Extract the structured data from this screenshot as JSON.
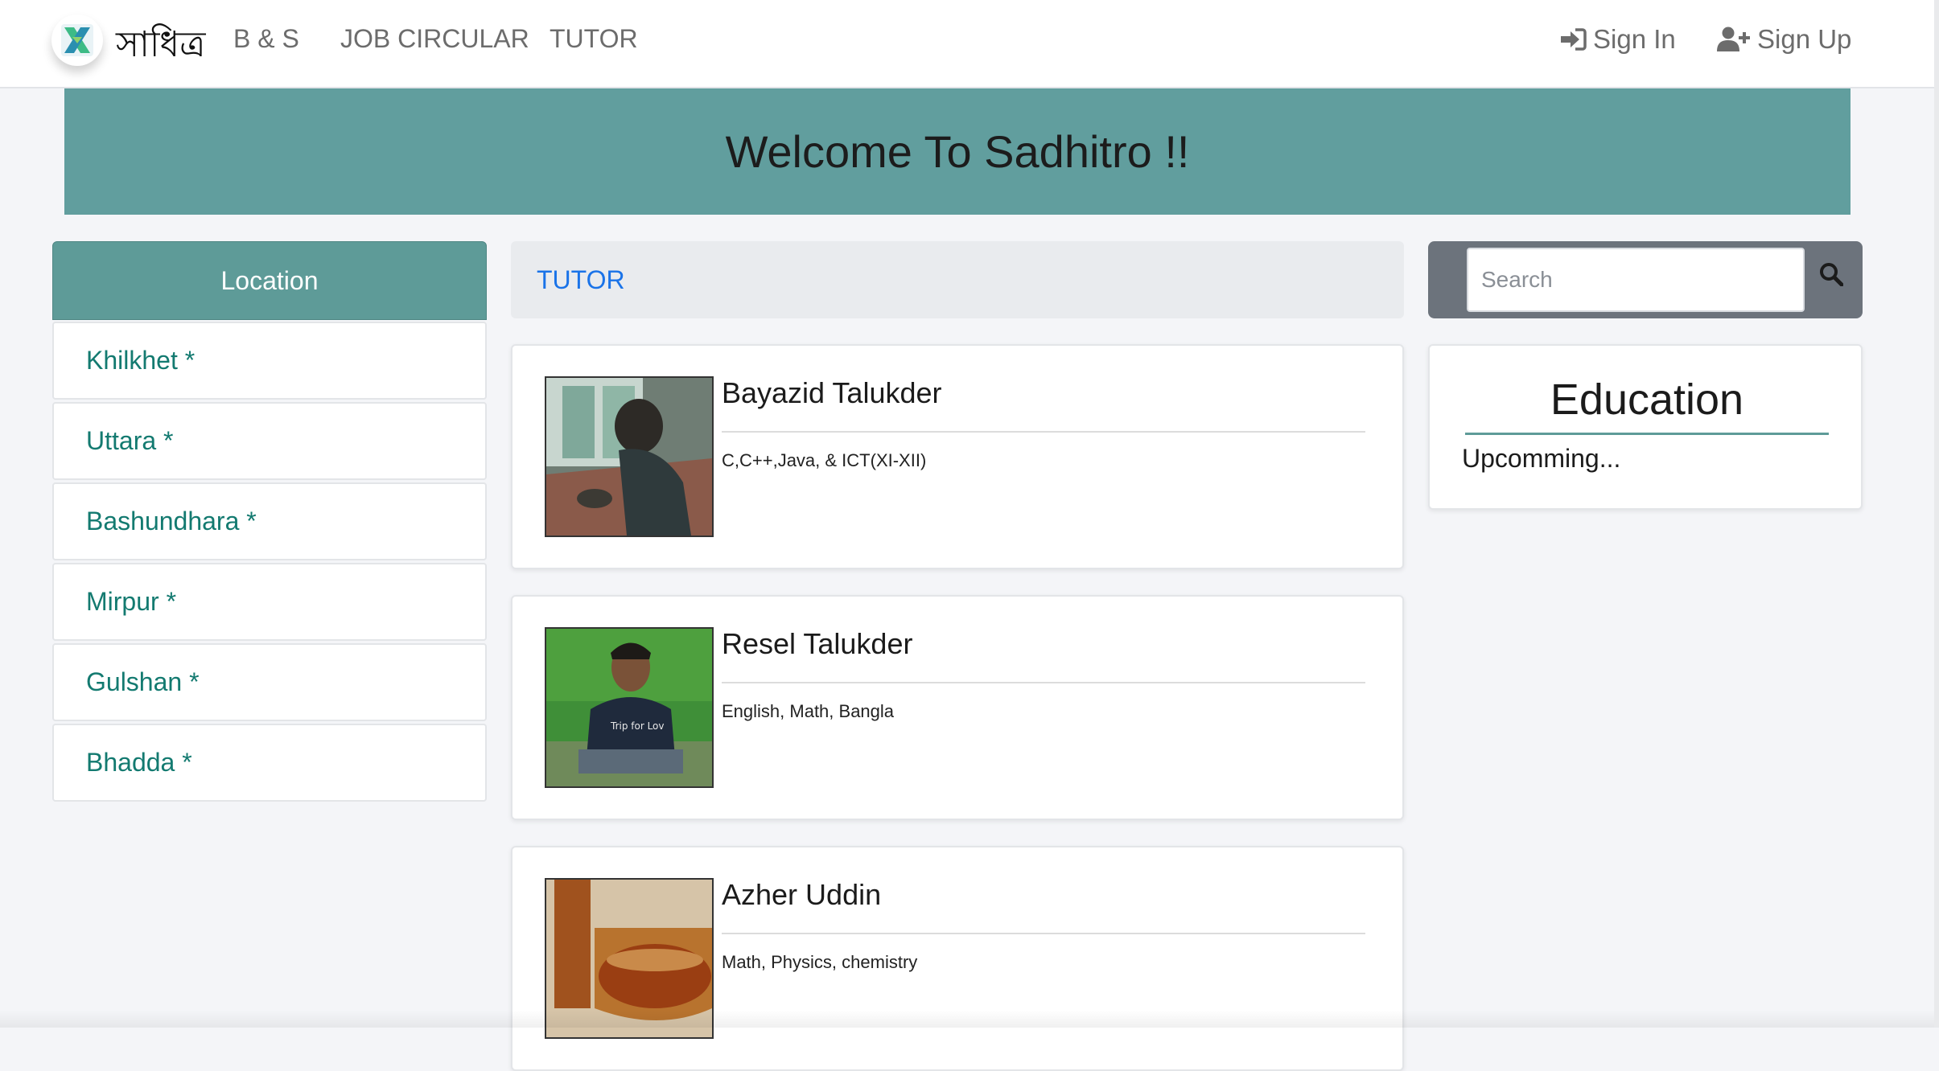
{
  "navbar": {
    "brand": "সাধিত্র",
    "links": [
      "B & S",
      "JOB CIRCULAR",
      "TUTOR"
    ],
    "sign_in": "Sign In",
    "sign_up": "Sign Up"
  },
  "banner": {
    "title": "Welcome To Sadhitro !!"
  },
  "sidebar": {
    "header": "Location",
    "items": [
      "Khilkhet *",
      "Uttara *",
      "Bashundhara *",
      "Mirpur *",
      "Gulshan *",
      "Bhadda *"
    ]
  },
  "main": {
    "section_label": "TUTOR",
    "tutors": [
      {
        "name": "Bayazid Talukder",
        "subjects": "C,C++,Java, & ICT(XI-XII)"
      },
      {
        "name": "Resel Talukder",
        "subjects": "English, Math, Bangla"
      },
      {
        "name": "Azher Uddin",
        "subjects": "Math, Physics, chemistry"
      }
    ]
  },
  "right": {
    "search_placeholder": "Search",
    "education_title": "Education",
    "education_text": "Upcomming..."
  },
  "colors": {
    "accent_teal": "#619e9e",
    "location_text": "#137a70",
    "link_blue": "#1a73e8"
  }
}
